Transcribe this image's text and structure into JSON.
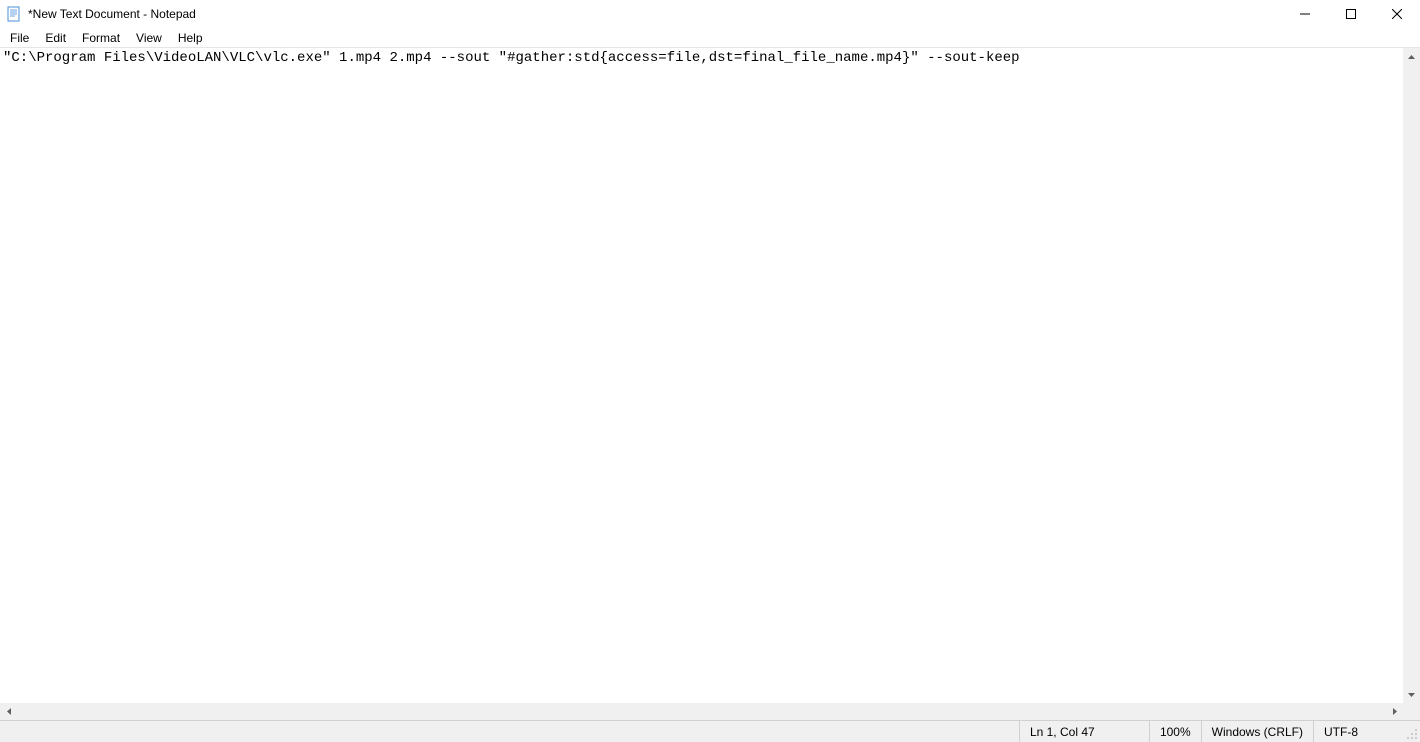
{
  "window": {
    "title": "*New Text Document - Notepad"
  },
  "menu": {
    "file": "File",
    "edit": "Edit",
    "format": "Format",
    "view": "View",
    "help": "Help"
  },
  "editor": {
    "content": "\"C:\\Program Files\\VideoLAN\\VLC\\vlc.exe\" 1.mp4 2.mp4 --sout \"#gather:std{access=file,dst=final_file_name.mp4}\" --sout-keep"
  },
  "statusbar": {
    "position": "Ln 1, Col 47",
    "zoom": "100%",
    "lineending": "Windows (CRLF)",
    "encoding": "UTF-8"
  }
}
